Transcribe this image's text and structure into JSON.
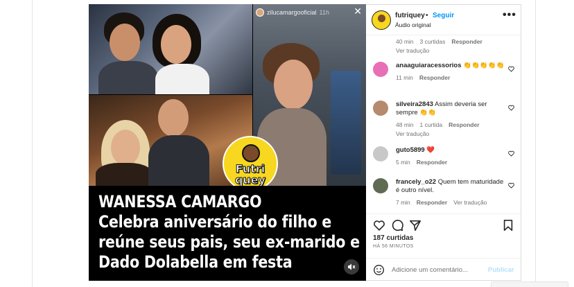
{
  "media": {
    "story": {
      "username": "zilucamargooficial",
      "time": "11h",
      "close_label": "✕"
    },
    "badge": {
      "line1": "Futri",
      "line2": "quey"
    },
    "caption": {
      "line1": "WANESSA CAMARGO",
      "line2": "Celebra aniversário do filho e",
      "line3": "reúne seus pais, seu ex-marido e",
      "line4": "Dado Dolabella em festa"
    },
    "mute_icon": "speaker-muted-icon"
  },
  "post": {
    "username": "futriquey",
    "separator": "•",
    "follow_label": "Seguir",
    "audio": "Áudio original",
    "more_label": "•••"
  },
  "comments": [
    {
      "username": "",
      "text": "",
      "time": "40 min",
      "likes": "3 curtidas",
      "reply": "Responder",
      "translate": "Ver tradução"
    },
    {
      "username": "anaaguiaracessorios",
      "text": "👏👏👏👏👏",
      "time": "11 min",
      "likes": "",
      "reply": "Responder",
      "translate": "",
      "avatar_color": "#e86fb6"
    },
    {
      "username": "silveira2843",
      "text": "Assim deveria ser sempre 👏👏",
      "time": "48 min",
      "likes": "1 curtida",
      "reply": "Responder",
      "translate": "Ver tradução",
      "avatar_color": "#b58a6d"
    },
    {
      "username": "guto5899",
      "text": "❤️",
      "time": "5 min",
      "likes": "",
      "reply": "Responder",
      "translate": "",
      "avatar_color": "#c8c8c8"
    },
    {
      "username": "francely_o22",
      "text": "Quem tem maturidade é outro nível.",
      "time": "7 min",
      "likes": "",
      "reply": "Responder",
      "translate": "Ver tradução",
      "avatar_color": "#5f6b52"
    }
  ],
  "actions": {
    "likes": "187 curtidas",
    "age": "HÁ 56 MINUTOS",
    "icons": [
      "heart-icon",
      "comment-icon",
      "share-icon",
      "bookmark-icon"
    ]
  },
  "composer": {
    "placeholder": "Adicione um comentário...",
    "publish_label": "Publicar"
  },
  "colors": {
    "accent": "#0095f6",
    "muted": "#737373",
    "badge": "#f7d71f"
  }
}
